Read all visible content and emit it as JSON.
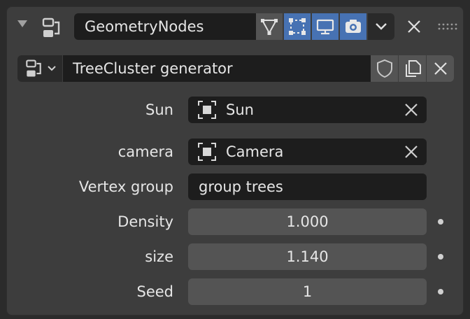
{
  "modifier": {
    "name": "GeometryNodes",
    "toggles": [
      {
        "icon": "edit-mode-icon",
        "active": false
      },
      {
        "icon": "cage-icon",
        "active": true
      },
      {
        "icon": "viewport-icon",
        "active": true
      },
      {
        "icon": "render-camera-icon",
        "active": true
      }
    ]
  },
  "node_group": {
    "name": "TreeCluster generator"
  },
  "properties": [
    {
      "label": "Sun",
      "kind": "object",
      "value": "Sun"
    },
    {
      "label": "camera",
      "kind": "object",
      "value": "Camera"
    },
    {
      "label": "Vertex group",
      "kind": "text",
      "value": "group trees"
    },
    {
      "label": "Density",
      "kind": "number",
      "value": "1.000"
    },
    {
      "label": "size",
      "kind": "number",
      "value": "1.140"
    },
    {
      "label": "Seed",
      "kind": "number",
      "value": "1"
    }
  ],
  "colors": {
    "panel": "#3d3d3d",
    "field": "#1d1d1d",
    "button": "#545454",
    "accent": "#4772b3"
  }
}
